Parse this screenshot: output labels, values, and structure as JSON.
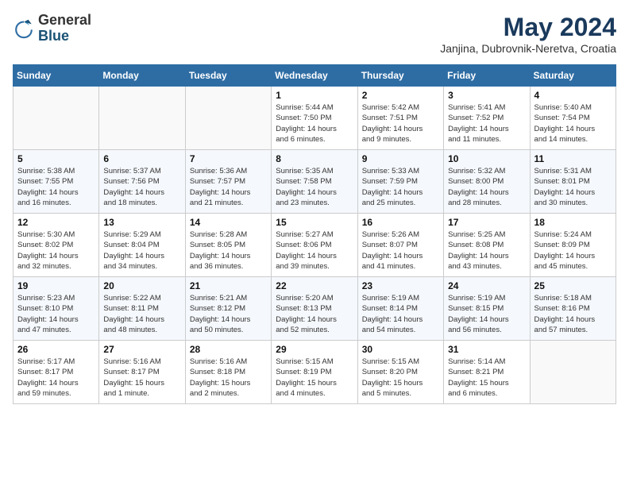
{
  "header": {
    "logo_general": "General",
    "logo_blue": "Blue",
    "month_title": "May 2024",
    "location": "Janjina, Dubrovnik-Neretva, Croatia"
  },
  "days_of_week": [
    "Sunday",
    "Monday",
    "Tuesday",
    "Wednesday",
    "Thursday",
    "Friday",
    "Saturday"
  ],
  "weeks": [
    [
      {
        "num": "",
        "info": ""
      },
      {
        "num": "",
        "info": ""
      },
      {
        "num": "",
        "info": ""
      },
      {
        "num": "1",
        "info": "Sunrise: 5:44 AM\nSunset: 7:50 PM\nDaylight: 14 hours\nand 6 minutes."
      },
      {
        "num": "2",
        "info": "Sunrise: 5:42 AM\nSunset: 7:51 PM\nDaylight: 14 hours\nand 9 minutes."
      },
      {
        "num": "3",
        "info": "Sunrise: 5:41 AM\nSunset: 7:52 PM\nDaylight: 14 hours\nand 11 minutes."
      },
      {
        "num": "4",
        "info": "Sunrise: 5:40 AM\nSunset: 7:54 PM\nDaylight: 14 hours\nand 14 minutes."
      }
    ],
    [
      {
        "num": "5",
        "info": "Sunrise: 5:38 AM\nSunset: 7:55 PM\nDaylight: 14 hours\nand 16 minutes."
      },
      {
        "num": "6",
        "info": "Sunrise: 5:37 AM\nSunset: 7:56 PM\nDaylight: 14 hours\nand 18 minutes."
      },
      {
        "num": "7",
        "info": "Sunrise: 5:36 AM\nSunset: 7:57 PM\nDaylight: 14 hours\nand 21 minutes."
      },
      {
        "num": "8",
        "info": "Sunrise: 5:35 AM\nSunset: 7:58 PM\nDaylight: 14 hours\nand 23 minutes."
      },
      {
        "num": "9",
        "info": "Sunrise: 5:33 AM\nSunset: 7:59 PM\nDaylight: 14 hours\nand 25 minutes."
      },
      {
        "num": "10",
        "info": "Sunrise: 5:32 AM\nSunset: 8:00 PM\nDaylight: 14 hours\nand 28 minutes."
      },
      {
        "num": "11",
        "info": "Sunrise: 5:31 AM\nSunset: 8:01 PM\nDaylight: 14 hours\nand 30 minutes."
      }
    ],
    [
      {
        "num": "12",
        "info": "Sunrise: 5:30 AM\nSunset: 8:02 PM\nDaylight: 14 hours\nand 32 minutes."
      },
      {
        "num": "13",
        "info": "Sunrise: 5:29 AM\nSunset: 8:04 PM\nDaylight: 14 hours\nand 34 minutes."
      },
      {
        "num": "14",
        "info": "Sunrise: 5:28 AM\nSunset: 8:05 PM\nDaylight: 14 hours\nand 36 minutes."
      },
      {
        "num": "15",
        "info": "Sunrise: 5:27 AM\nSunset: 8:06 PM\nDaylight: 14 hours\nand 39 minutes."
      },
      {
        "num": "16",
        "info": "Sunrise: 5:26 AM\nSunset: 8:07 PM\nDaylight: 14 hours\nand 41 minutes."
      },
      {
        "num": "17",
        "info": "Sunrise: 5:25 AM\nSunset: 8:08 PM\nDaylight: 14 hours\nand 43 minutes."
      },
      {
        "num": "18",
        "info": "Sunrise: 5:24 AM\nSunset: 8:09 PM\nDaylight: 14 hours\nand 45 minutes."
      }
    ],
    [
      {
        "num": "19",
        "info": "Sunrise: 5:23 AM\nSunset: 8:10 PM\nDaylight: 14 hours\nand 47 minutes."
      },
      {
        "num": "20",
        "info": "Sunrise: 5:22 AM\nSunset: 8:11 PM\nDaylight: 14 hours\nand 48 minutes."
      },
      {
        "num": "21",
        "info": "Sunrise: 5:21 AM\nSunset: 8:12 PM\nDaylight: 14 hours\nand 50 minutes."
      },
      {
        "num": "22",
        "info": "Sunrise: 5:20 AM\nSunset: 8:13 PM\nDaylight: 14 hours\nand 52 minutes."
      },
      {
        "num": "23",
        "info": "Sunrise: 5:19 AM\nSunset: 8:14 PM\nDaylight: 14 hours\nand 54 minutes."
      },
      {
        "num": "24",
        "info": "Sunrise: 5:19 AM\nSunset: 8:15 PM\nDaylight: 14 hours\nand 56 minutes."
      },
      {
        "num": "25",
        "info": "Sunrise: 5:18 AM\nSunset: 8:16 PM\nDaylight: 14 hours\nand 57 minutes."
      }
    ],
    [
      {
        "num": "26",
        "info": "Sunrise: 5:17 AM\nSunset: 8:17 PM\nDaylight: 14 hours\nand 59 minutes."
      },
      {
        "num": "27",
        "info": "Sunrise: 5:16 AM\nSunset: 8:17 PM\nDaylight: 15 hours\nand 1 minute."
      },
      {
        "num": "28",
        "info": "Sunrise: 5:16 AM\nSunset: 8:18 PM\nDaylight: 15 hours\nand 2 minutes."
      },
      {
        "num": "29",
        "info": "Sunrise: 5:15 AM\nSunset: 8:19 PM\nDaylight: 15 hours\nand 4 minutes."
      },
      {
        "num": "30",
        "info": "Sunrise: 5:15 AM\nSunset: 8:20 PM\nDaylight: 15 hours\nand 5 minutes."
      },
      {
        "num": "31",
        "info": "Sunrise: 5:14 AM\nSunset: 8:21 PM\nDaylight: 15 hours\nand 6 minutes."
      },
      {
        "num": "",
        "info": ""
      }
    ]
  ]
}
